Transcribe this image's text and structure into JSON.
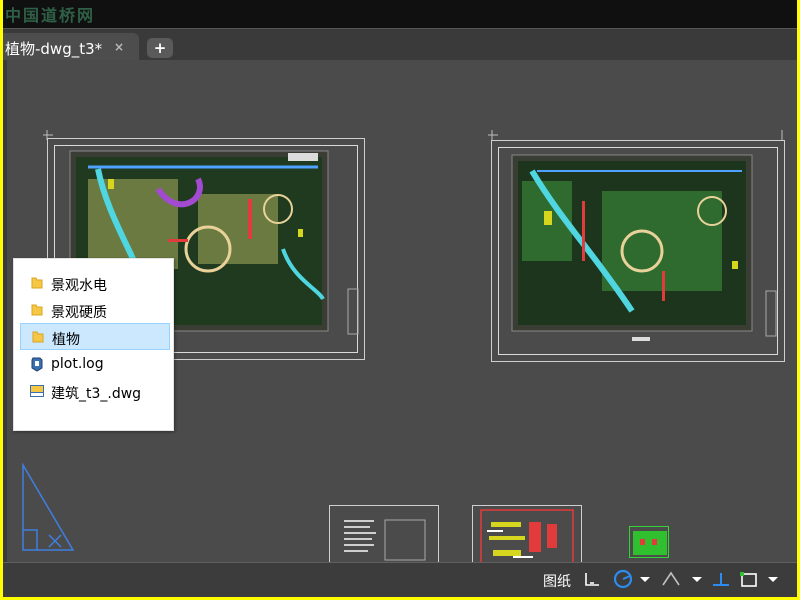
{
  "titlebar": {
    "watermark": "中国道桥网"
  },
  "tabs": [
    {
      "label": "植物-dwg_t3*",
      "active": true
    }
  ],
  "tab_close_glyph": "×",
  "new_tab_glyph": "+",
  "menu": {
    "items": [
      {
        "label": "景观水电",
        "icon": "folder-icon",
        "selected": false
      },
      {
        "label": "景观硬质",
        "icon": "folder-icon",
        "selected": false
      },
      {
        "label": "植物",
        "icon": "folder-icon",
        "selected": true
      },
      {
        "label": "plot.log",
        "icon": "log-file-icon",
        "selected": false
      },
      {
        "label": "建筑_t3_.dwg",
        "icon": "dwg-file-icon",
        "selected": false
      }
    ]
  },
  "statusbar": {
    "space_label": "图纸"
  },
  "colors": {
    "canvas_bg": "#4b4b4b",
    "outer_border": "#ffff00",
    "menu_selected": "#cce8ff",
    "folder_yellow": "#f6c744",
    "accent_blue": "#2d8cf0"
  }
}
